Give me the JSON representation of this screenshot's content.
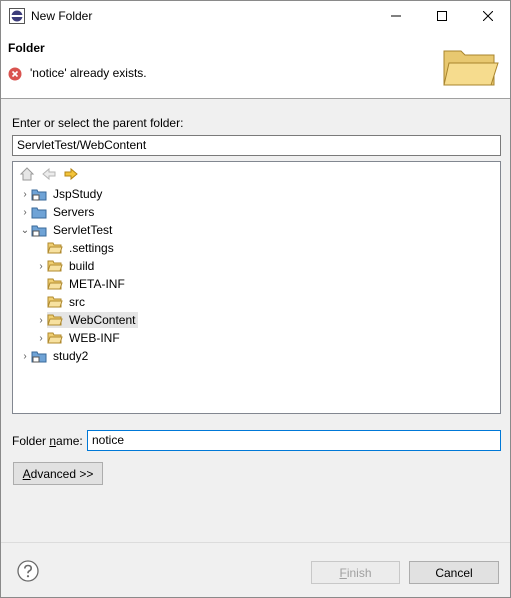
{
  "window": {
    "title": "New Folder"
  },
  "banner": {
    "title": "Folder",
    "message": "'notice' already exists."
  },
  "parent_folder": {
    "label": "Enter or select the parent folder:",
    "value": "ServletTest/WebContent"
  },
  "tree": {
    "items": [
      {
        "label": "JspStudy",
        "expander": "›"
      },
      {
        "label": "Servers",
        "expander": "›"
      },
      {
        "label": "ServletTest",
        "expander": "⌄"
      },
      {
        "label": ".settings",
        "expander": ""
      },
      {
        "label": "build",
        "expander": "›"
      },
      {
        "label": "META-INF",
        "expander": ""
      },
      {
        "label": "src",
        "expander": ""
      },
      {
        "label": "WebContent",
        "expander": "›"
      },
      {
        "label": "WEB-INF",
        "expander": "›"
      },
      {
        "label": "study2",
        "expander": "›"
      }
    ]
  },
  "folder_name": {
    "label_pre": "Folder ",
    "label_u": "n",
    "label_post": "ame:",
    "value": "notice"
  },
  "advanced": {
    "label_u": "A",
    "label_rest": "dvanced >>"
  },
  "buttons": {
    "finish_u": "F",
    "finish_rest": "inish",
    "cancel": "Cancel"
  },
  "colors": {
    "accent": "#0078d7",
    "error": "#d9534f",
    "folder": "#e8b84a"
  }
}
